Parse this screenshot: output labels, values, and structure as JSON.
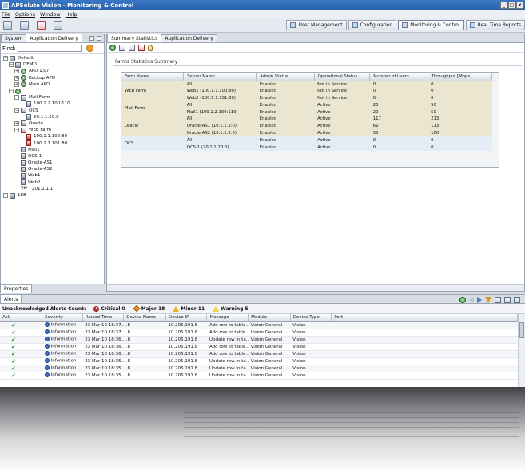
{
  "window": {
    "title": "APSolute Vision - Monitoring & Control",
    "min": "_",
    "max": "□",
    "close": "x"
  },
  "menu": [
    "File",
    "Options",
    "Window",
    "Help"
  ],
  "perspectives": [
    {
      "label": "User Management",
      "icon": "users-icon"
    },
    {
      "label": "Configuration",
      "icon": "configuration-icon"
    },
    {
      "label": "Monitoring & Control",
      "icon": "monitor-icon",
      "active": true
    },
    {
      "label": "Real Time Reports",
      "icon": "report-icon"
    }
  ],
  "left_panel": {
    "tabs": [
      "System",
      "Application Delivery"
    ],
    "find_label": "Find:",
    "find_value": "",
    "tree": [
      {
        "label": "Default",
        "level": 0,
        "exp": "−",
        "icon": "grp"
      },
      {
        "label": "DEMO",
        "level": 1,
        "exp": "−",
        "icon": "grp"
      },
      {
        "label": "APD 1.07",
        "level": 2,
        "exp": "+",
        "icon": "apd"
      },
      {
        "label": "Backup APD",
        "level": 2,
        "exp": "+",
        "icon": "apd"
      },
      {
        "label": "Main APD",
        "level": 2,
        "exp": "+",
        "icon": "apd"
      },
      {
        "label": "",
        "level": 1,
        "exp": "−",
        "icon": "apd"
      },
      {
        "label": "Mail Farm",
        "level": 2,
        "exp": "−",
        "icon": "farm"
      },
      {
        "label": "100.1.2.100:110",
        "level": 3,
        "exp": "",
        "icon": "srv"
      },
      {
        "label": "OCS",
        "level": 2,
        "exp": "−",
        "icon": "farm"
      },
      {
        "label": "20.1.1.20:0",
        "level": 3,
        "exp": "",
        "icon": "srv"
      },
      {
        "label": "Oracle",
        "level": 2,
        "exp": "+",
        "icon": "farm"
      },
      {
        "label": "WEB Farm",
        "level": 2,
        "exp": "−",
        "icon": "farmerr"
      },
      {
        "label": "100.1.1.100:80",
        "level": 3,
        "exp": "",
        "icon": "srverr"
      },
      {
        "label": "100.1.1.101:80",
        "level": 3,
        "exp": "",
        "icon": "srverr"
      },
      {
        "label": "Mail1",
        "level": 2,
        "exp": "",
        "icon": "srv"
      },
      {
        "label": "OCS-1",
        "level": 2,
        "exp": "",
        "icon": "srv"
      },
      {
        "label": "Oracle-AS1",
        "level": 2,
        "exp": "",
        "icon": "srv"
      },
      {
        "label": "Oracle-AS2",
        "level": 2,
        "exp": "",
        "icon": "srv"
      },
      {
        "label": "Web1",
        "level": 2,
        "exp": "",
        "icon": "srv"
      },
      {
        "label": "Web2",
        "level": 2,
        "exp": "",
        "icon": "srv"
      },
      {
        "label": "201.1.1.1",
        "level": 2,
        "exp": "",
        "icon": "vip",
        "prefix": "VIP"
      },
      {
        "label": "188",
        "level": 0,
        "exp": "+",
        "icon": "grp"
      }
    ],
    "properties_tab": "Properties"
  },
  "right_panel": {
    "tabs": [
      "Summary Statistics",
      "Application Delivery"
    ],
    "summary_title": "Farms Statistics Summary",
    "columns": [
      "Farm Name",
      "Server Name",
      "Admin Status",
      "Operational Status",
      "Number of Users",
      "Throughput [Mbps]"
    ],
    "groups": [
      {
        "farm": "WEB Farm",
        "shade": "a",
        "rows": [
          [
            "All",
            "Enabled",
            "Not in Service",
            "0",
            "0"
          ],
          [
            "Web1 (100.1.1.100:80)",
            "Enabled",
            "Not in Service",
            "0",
            "0"
          ],
          [
            "Web2 (100.1.1.101:80)",
            "Enabled",
            "Not in Service",
            "0",
            "0"
          ]
        ]
      },
      {
        "farm": "Mail Farm",
        "shade": "a",
        "rows": [
          [
            "All",
            "Enabled",
            "Active",
            "20",
            "50"
          ],
          [
            "Mail1 (100.1.2.100:110)",
            "Enabled",
            "Active",
            "20",
            "50"
          ]
        ]
      },
      {
        "farm": "Oracle",
        "shade": "a",
        "rows": [
          [
            "All",
            "Enabled",
            "Active",
            "117",
            "213"
          ],
          [
            "Oracle-AS1 (10.1.1.1:0)",
            "Enabled",
            "Active",
            "62",
            "113"
          ],
          [
            "Oracle-AS2 (10.1.1.2:0)",
            "Enabled",
            "Active",
            "55",
            "100"
          ]
        ]
      },
      {
        "farm": "OCS",
        "shade": "b",
        "rows": [
          [
            "All",
            "Enabled",
            "Active",
            "0",
            "0"
          ],
          [
            "OCS-1 (20.1.1.20:0)",
            "Enabled",
            "Active",
            "0",
            "0"
          ]
        ]
      }
    ]
  },
  "alerts": {
    "tab": "Alerts",
    "counts_label": "Unacknowledged Alerts Count:",
    "critical": "Critical 0",
    "major": "Major 18",
    "minor": "Minor 11",
    "warning": "Warning 5",
    "columns": [
      "Ack",
      "Severity",
      "Raised Time",
      "Device Name",
      "Device IP",
      "Message",
      "Module",
      "Device Type",
      "Port"
    ],
    "rows": [
      [
        "Information",
        "23 Mar 10 18:37....",
        ".8",
        "10.205.191.8",
        "Add row to table...",
        "Vision General",
        "Vision",
        ""
      ],
      [
        "Information",
        "23 Mar 10 18:37....",
        ".8",
        "10.205.191.8",
        "Add row to table...",
        "Vision General",
        "Vision",
        ""
      ],
      [
        "Information",
        "23 Mar 10 18:36....",
        ".8",
        "10.205.191.8",
        "Update row in ta...",
        "Vision General",
        "Vision",
        ""
      ],
      [
        "Information",
        "23 Mar 10 18:36....",
        ".8",
        "10.205.191.8",
        "Add row to table...",
        "Vision General",
        "Vision",
        ""
      ],
      [
        "Information",
        "23 Mar 10 18:36....",
        ".8",
        "10.205.191.8",
        "Add row to table...",
        "Vision General",
        "Vision",
        ""
      ],
      [
        "Information",
        "23 Mar 10 18:35....",
        ".8",
        "10.205.191.8",
        "Update row in ta...",
        "Vision General",
        "Vision",
        ""
      ],
      [
        "Information",
        "23 Mar 10 18:35....",
        ".8",
        "10.205.191.8",
        "Update row in ta...",
        "Vision General",
        "Vision",
        ""
      ],
      [
        "Information",
        "23 Mar 10 18:35....",
        ".8",
        "10.205.191.8",
        "Update row in ta...",
        "Vision General",
        "Vision",
        ""
      ]
    ]
  }
}
